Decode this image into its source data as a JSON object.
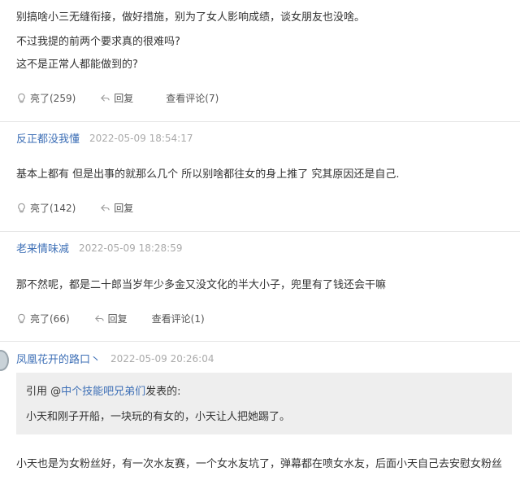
{
  "top_post": {
    "lines": [
      "别搞啥小三无缝衔接，做好措施，别为了女人影响成绩，谈女朋友也没啥。",
      "不过我提的前两个要求真的很难吗?",
      "这不是正常人都能做到的?"
    ],
    "like": "亮了(259)",
    "reply": "回复",
    "view_comments": "查看评论(7)"
  },
  "post1": {
    "username": "反正都没我懂",
    "time": "2022-05-09 18:54:17",
    "content": "基本上都有 但是出事的就那么几个 所以别啥都往女的身上推了 究其原因还是自己.",
    "like": "亮了(142)",
    "reply": "回复"
  },
  "post2": {
    "username": "老来情味减",
    "time": "2022-05-09 18:28:59",
    "content": "那不然呢，都是二十郎当岁年少多金又没文化的半大小子，兜里有了钱还会干嘛",
    "like": "亮了(66)",
    "reply": "回复",
    "view_comments": "查看评论(1)"
  },
  "post3": {
    "username": "凤凰花开的路口丶",
    "time": "2022-05-09 20:26:04",
    "quote_prefix": "引用 @",
    "quote_user": "中个技能吧兄弟们",
    "quote_suffix": "发表的:",
    "quote_text": "小天和刚子开船，一块玩的有女的，小天让人把她踢了。",
    "content": "小天也是为女粉丝好，有一次水友赛，一个女水友坑了，弹幕都在喷女水友，后面小天自己去安慰女粉丝"
  },
  "icons": {
    "like": "lightbulb-icon",
    "reply": "reply-arrow-icon"
  },
  "colors": {
    "username": "#3d6fb6",
    "quote_bg": "#eeeeee",
    "divider": "#e6e6e6"
  }
}
